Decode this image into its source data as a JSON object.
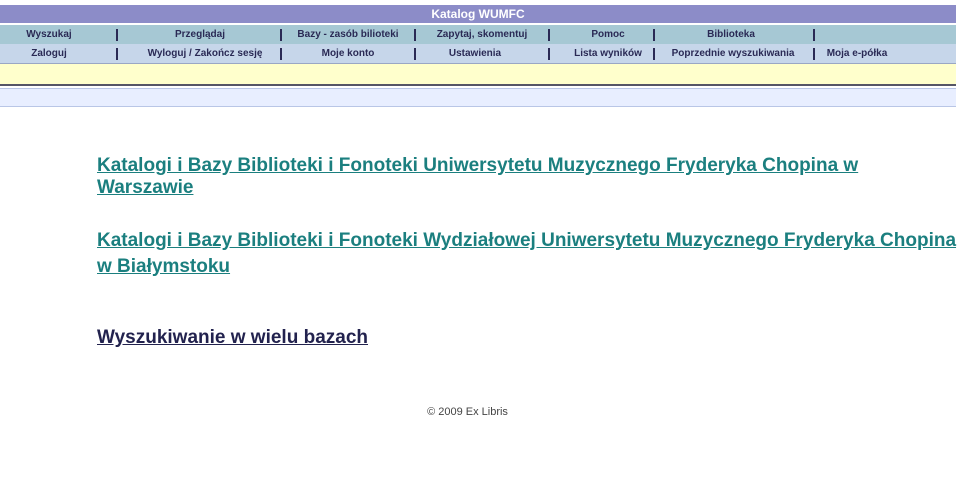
{
  "header": {
    "title": "Katalog WUMFC"
  },
  "nav_row1": [
    {
      "label": "Wyszukaj"
    },
    {
      "label": "Przeglądaj"
    },
    {
      "label": "Bazy - zasób bilioteki"
    },
    {
      "label": "Zapytaj, skomentuj"
    },
    {
      "label": "Pomoc"
    },
    {
      "label": "Biblioteka"
    }
  ],
  "nav_row2": [
    {
      "label": "Zaloguj"
    },
    {
      "label": "Wyloguj / Zakończ sesję"
    },
    {
      "label": "Moje konto"
    },
    {
      "label": "Ustawienia"
    },
    {
      "label": "Lista wyników"
    },
    {
      "label": "Poprzednie wyszukiwania"
    },
    {
      "label": "Moja e-półka"
    }
  ],
  "main": {
    "link_warszawa": "Katalogi i Bazy Biblioteki i Fonoteki Uniwersytetu Muzycznego Fryderyka Chopina w Warszawie",
    "link_bialystok_line1": "Katalogi i Bazy Biblioteki i Fonoteki Wydziałowej Uniwersytetu Muzycznego Fryderyka Chopina",
    "link_bialystok_line2": "w Białymstoku",
    "link_multi": "Wyszukiwanie w wielu bazach"
  },
  "footer": {
    "copyright": "© 2009 Ex Libris"
  },
  "colors": {
    "title_bar": "#8c8cc8",
    "nav_row1": "#a6c8d4",
    "nav_row2": "#c6d6ea",
    "link_teal": "#1b7f7f",
    "link_navy": "#22224e",
    "yellow_bar": "#ffffcc"
  }
}
